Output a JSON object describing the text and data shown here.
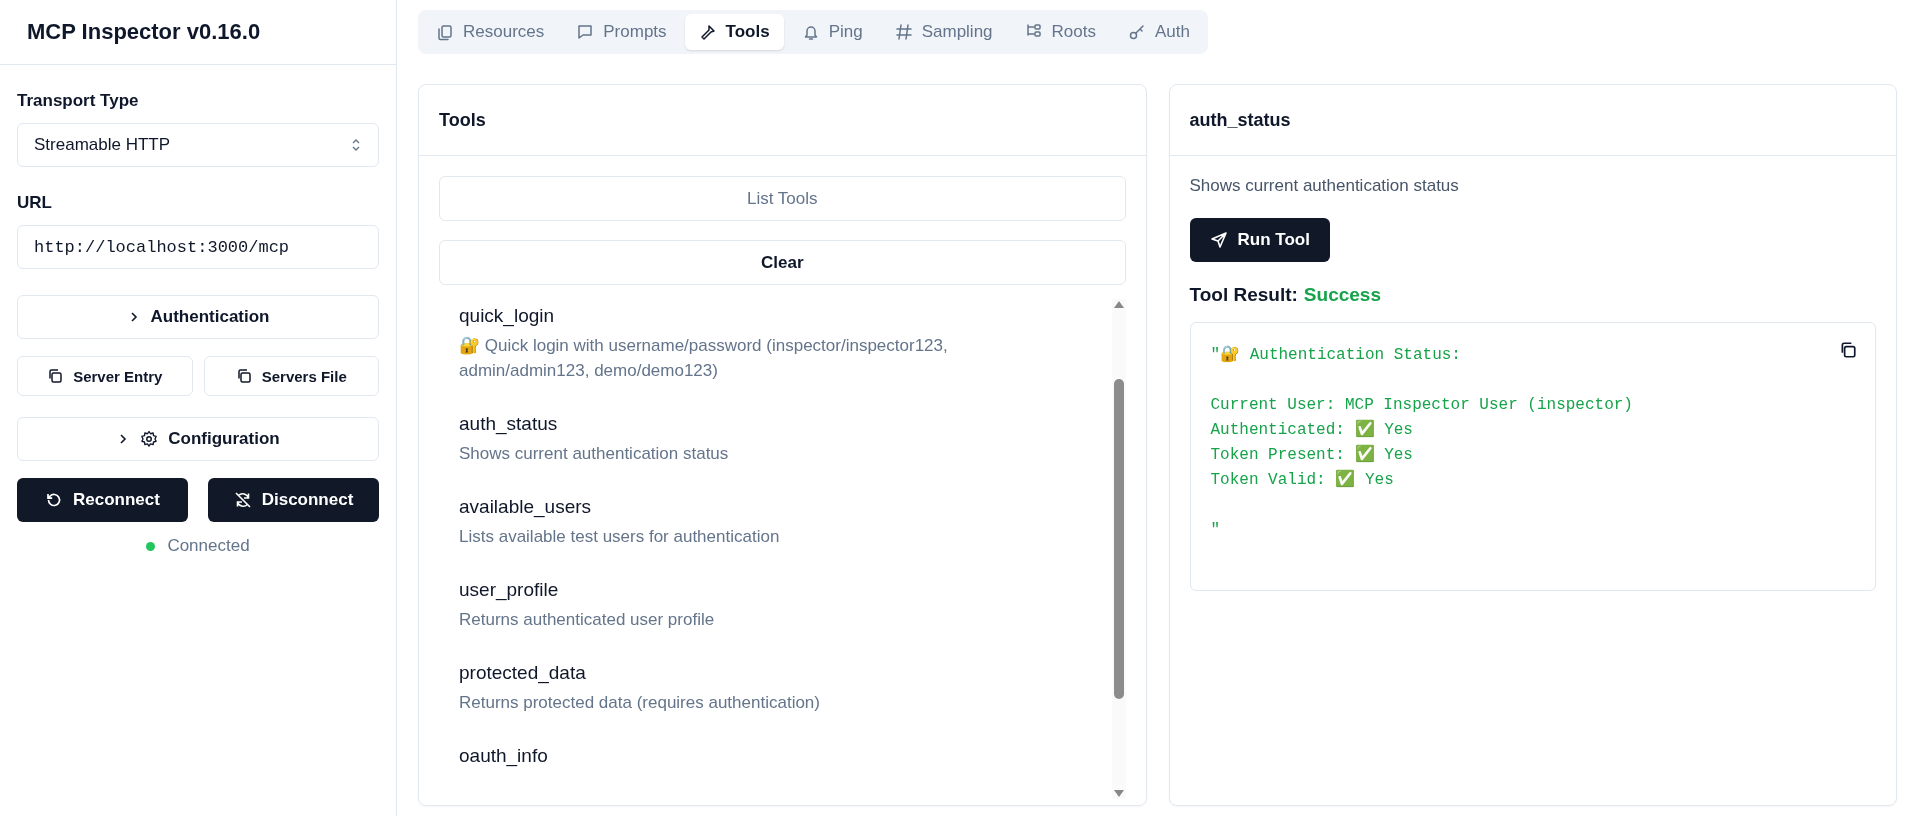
{
  "sidebar": {
    "title": "MCP Inspector v0.16.0",
    "transport": {
      "label": "Transport Type",
      "value": "Streamable HTTP"
    },
    "url": {
      "label": "URL",
      "value": "http://localhost:3000/mcp"
    },
    "authentication": {
      "label": "Authentication",
      "expanded": false
    },
    "copy_buttons": [
      "Server Entry",
      "Servers File"
    ],
    "configuration": {
      "label": "Configuration",
      "expanded": false
    },
    "actions": [
      "Reconnect",
      "Disconnect"
    ],
    "status": {
      "label": "Connected",
      "connected": true
    }
  },
  "tabs": [
    {
      "label": "Resources",
      "selected": false
    },
    {
      "label": "Prompts",
      "selected": false
    },
    {
      "label": "Tools",
      "selected": true
    },
    {
      "label": "Ping",
      "selected": false
    },
    {
      "label": "Sampling",
      "selected": false
    },
    {
      "label": "Roots",
      "selected": false
    },
    {
      "label": "Auth",
      "selected": false
    }
  ],
  "tools_panel": {
    "title": "Tools",
    "list_button": {
      "label": "List Tools",
      "disabled": true
    },
    "clear_button": "Clear",
    "tools": [
      {
        "name": "quick_login",
        "description": "🔐 Quick login with username/password (inspector/inspector123, admin/admin123, demo/demo123)"
      },
      {
        "name": "auth_status",
        "description": "Shows current authentication status"
      },
      {
        "name": "available_users",
        "description": "Lists available test users for authentication"
      },
      {
        "name": "user_profile",
        "description": "Returns authenticated user profile"
      },
      {
        "name": "protected_data",
        "description": "Returns protected data (requires authentication)"
      },
      {
        "name": "oauth_info"
      }
    ]
  },
  "detail_panel": {
    "title": "auth_status",
    "description": "Shows current authentication status",
    "run_button": "Run Tool",
    "result_label": "Tool Result:",
    "result_status": "Success",
    "result_blocks": [
      [
        "\"🔐 Authentication Status:"
      ],
      [
        "Current User: MCP Inspector User (inspector)",
        "Authenticated: ✅ Yes",
        "Token Present: ✅ Yes",
        "Token Valid: ✅ Yes"
      ],
      [
        "\""
      ]
    ]
  }
}
